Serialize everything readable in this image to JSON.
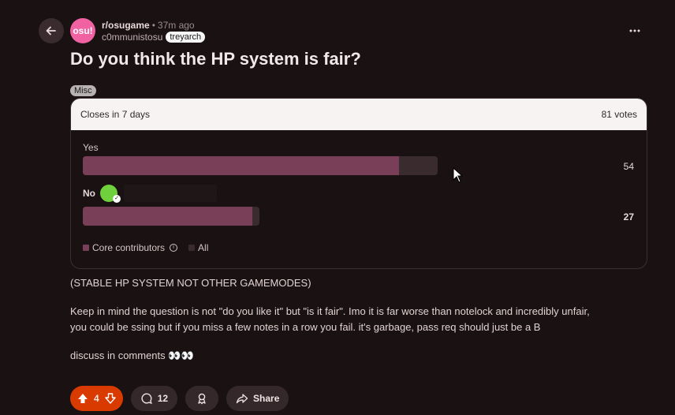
{
  "header": {
    "avatar_text": "osu!",
    "subreddit": "r/osugame",
    "separator": "•",
    "time": "37m ago",
    "author": "c0mmunistosu",
    "user_flair": "treyarch"
  },
  "post": {
    "title": "Do you think the HP system is fair?",
    "flair": "Misc",
    "paragraphs": [
      "(STABLE HP SYSTEM NOT OTHER GAMEMODES)",
      "Keep in mind the question is not \"do you like it\" but \"is it fair\". Imo it is far worse than notelock and incredibly unfair,",
      "you could be ssing but if you miss a few notes in a row you fail. it's garbage, pass req should just be a B",
      "discuss in comments 👀👀"
    ]
  },
  "poll": {
    "closes": "Closes in 7 days",
    "votes": "81 votes",
    "options": [
      {
        "label": "Yes",
        "count": "54",
        "fill_fraction": 0.89
      },
      {
        "label": "No",
        "count": "27",
        "fill_fraction": 0.96
      }
    ],
    "legend": {
      "core": "Core contributors",
      "all": "All"
    },
    "colors": {
      "core": "#7a3f58",
      "all": "#3a2c2e"
    }
  },
  "actions": {
    "score": "4",
    "comments": "12",
    "share": "Share"
  },
  "colors": {
    "vote_accent": "#d93a00",
    "subreddit_icon": "#f062a1"
  }
}
